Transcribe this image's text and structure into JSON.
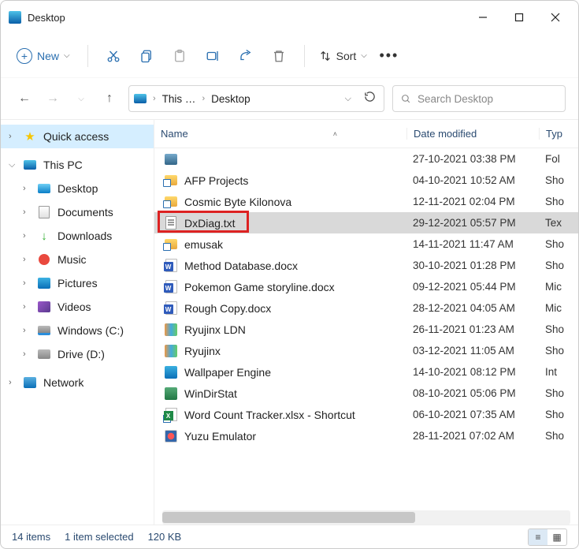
{
  "window": {
    "title": "Desktop"
  },
  "toolbar": {
    "new_label": "New",
    "sort_label": "Sort"
  },
  "address": {
    "crumb1": "This …",
    "crumb2": "Desktop"
  },
  "search": {
    "placeholder": "Search Desktop"
  },
  "sidebar": {
    "quick_access": "Quick access",
    "this_pc": "This PC",
    "desktop": "Desktop",
    "documents": "Documents",
    "downloads": "Downloads",
    "music": "Music",
    "pictures": "Pictures",
    "videos": "Videos",
    "windows_c": "Windows (C:)",
    "drive_d": "Drive (D:)",
    "network": "Network"
  },
  "columns": {
    "name": "Name",
    "date": "Date modified",
    "type": "Typ"
  },
  "files": [
    {
      "name": "",
      "date": "27-10-2021 03:38 PM",
      "type": "Fol",
      "icon": "img"
    },
    {
      "name": "AFP Projects",
      "date": "04-10-2021 10:52 AM",
      "type": "Sho",
      "icon": "folder-sc"
    },
    {
      "name": "Cosmic Byte Kilonova",
      "date": "12-11-2021 02:04 PM",
      "type": "Sho",
      "icon": "folder-sc"
    },
    {
      "name": "DxDiag.txt",
      "date": "29-12-2021 05:57 PM",
      "type": "Tex",
      "icon": "txt",
      "selected": true,
      "highlight": true
    },
    {
      "name": "emusak",
      "date": "14-11-2021 11:47 AM",
      "type": "Sho",
      "icon": "folder-sc"
    },
    {
      "name": "Method Database.docx",
      "date": "30-10-2021 01:28 PM",
      "type": "Sho",
      "icon": "docx"
    },
    {
      "name": "Pokemon Game storyline.docx",
      "date": "09-12-2021 05:44 PM",
      "type": "Mic",
      "icon": "docx"
    },
    {
      "name": "Rough Copy.docx",
      "date": "28-12-2021 04:05 AM",
      "type": "Mic",
      "icon": "docx"
    },
    {
      "name": "Ryujinx LDN",
      "date": "26-11-2021 01:23 AM",
      "type": "Sho",
      "icon": "app-ryu"
    },
    {
      "name": "Ryujinx",
      "date": "03-12-2021 11:05 AM",
      "type": "Sho",
      "icon": "app-ryu"
    },
    {
      "name": "Wallpaper Engine",
      "date": "14-10-2021 08:12 PM",
      "type": "Int",
      "icon": "app-we"
    },
    {
      "name": "WinDirStat",
      "date": "08-10-2021 05:06 PM",
      "type": "Sho",
      "icon": "app-wds"
    },
    {
      "name": "Word Count Tracker.xlsx - Shortcut",
      "date": "06-10-2021 07:35 AM",
      "type": "Sho",
      "icon": "xlsx-sc"
    },
    {
      "name": "Yuzu Emulator",
      "date": "28-11-2021 07:02 AM",
      "type": "Sho",
      "icon": "app-yuzu"
    }
  ],
  "status": {
    "count": "14 items",
    "selected": "1 item selected",
    "size": "120 KB"
  },
  "colors": {
    "accent": "#2a6fb0",
    "highlight": "#d22"
  }
}
